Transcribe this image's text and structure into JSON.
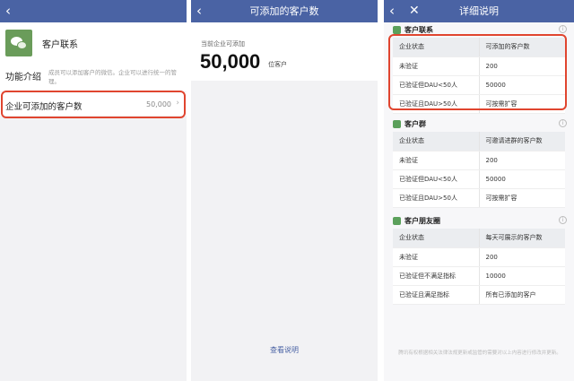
{
  "panel1": {
    "app_name": "客户联系",
    "func_label": "功能介绍",
    "func_desc": "成员可以添加客户的微信。企业可以进行统一的管理。",
    "limit_label": "企业可添加的客户数",
    "limit_value": "50,000",
    "chevron": "›"
  },
  "panel2": {
    "title": "可添加的客户数",
    "sub_label": "当前企业可添加",
    "big_number": "50,000",
    "unit": "位客户",
    "view_link": "查看说明"
  },
  "panel3": {
    "title": "详细说明",
    "sections": [
      {
        "title": "客户联系",
        "headers": [
          "企业状态",
          "可添加的客户数"
        ],
        "rows": [
          [
            "未验证",
            "200"
          ],
          [
            "已验证但DAU<50人",
            "50000"
          ],
          [
            "已验证且DAU>50人",
            "可按需扩容"
          ]
        ]
      },
      {
        "title": "客户群",
        "headers": [
          "企业状态",
          "可邀请进群的客户数"
        ],
        "rows": [
          [
            "未验证",
            "200"
          ],
          [
            "已验证但DAU<50人",
            "50000"
          ],
          [
            "已验证且DAU>50人",
            "可按需扩容"
          ]
        ]
      },
      {
        "title": "客户朋友圈",
        "headers": [
          "企业状态",
          "每天可展示的客户数"
        ],
        "rows": [
          [
            "未验证",
            "200"
          ],
          [
            "已验证但不满足指标",
            "10000"
          ],
          [
            "已验证且满足指标",
            "所有已添加的客户"
          ]
        ]
      }
    ],
    "footer": "腾讯有权根据相关法律法规更新或监管的需要对以上内容进行修改并更新。"
  },
  "icons": {
    "back": "‹",
    "close": "✕",
    "info": "i"
  },
  "colors": {
    "nav": "#4a63a4",
    "highlight": "#e0452f",
    "app_icon": "#6a9c5a"
  }
}
